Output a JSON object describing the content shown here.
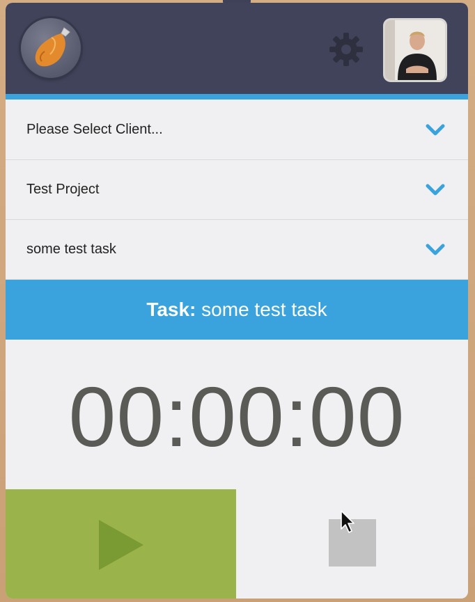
{
  "header": {
    "logo_icon": "stopwatch-flask-logo-icon",
    "settings_icon": "gear-icon",
    "avatar_alt": "user avatar"
  },
  "selectors": [
    {
      "label": "Please Select Client...",
      "icon": "chevron-down-icon"
    },
    {
      "label": "Test Project",
      "icon": "chevron-down-icon"
    },
    {
      "label": "some test task",
      "icon": "chevron-down-icon"
    }
  ],
  "task_bar": {
    "prefix": "Task:",
    "name": " some test task"
  },
  "timer": {
    "value": "00:00:00"
  },
  "controls": {
    "play_icon": "play-icon",
    "stop_icon": "stop-icon"
  },
  "colors": {
    "header_bg": "#40435a",
    "accent_blue": "#3aa3dd",
    "play_green": "#9ab34a",
    "timer_text": "#5a5a56"
  }
}
